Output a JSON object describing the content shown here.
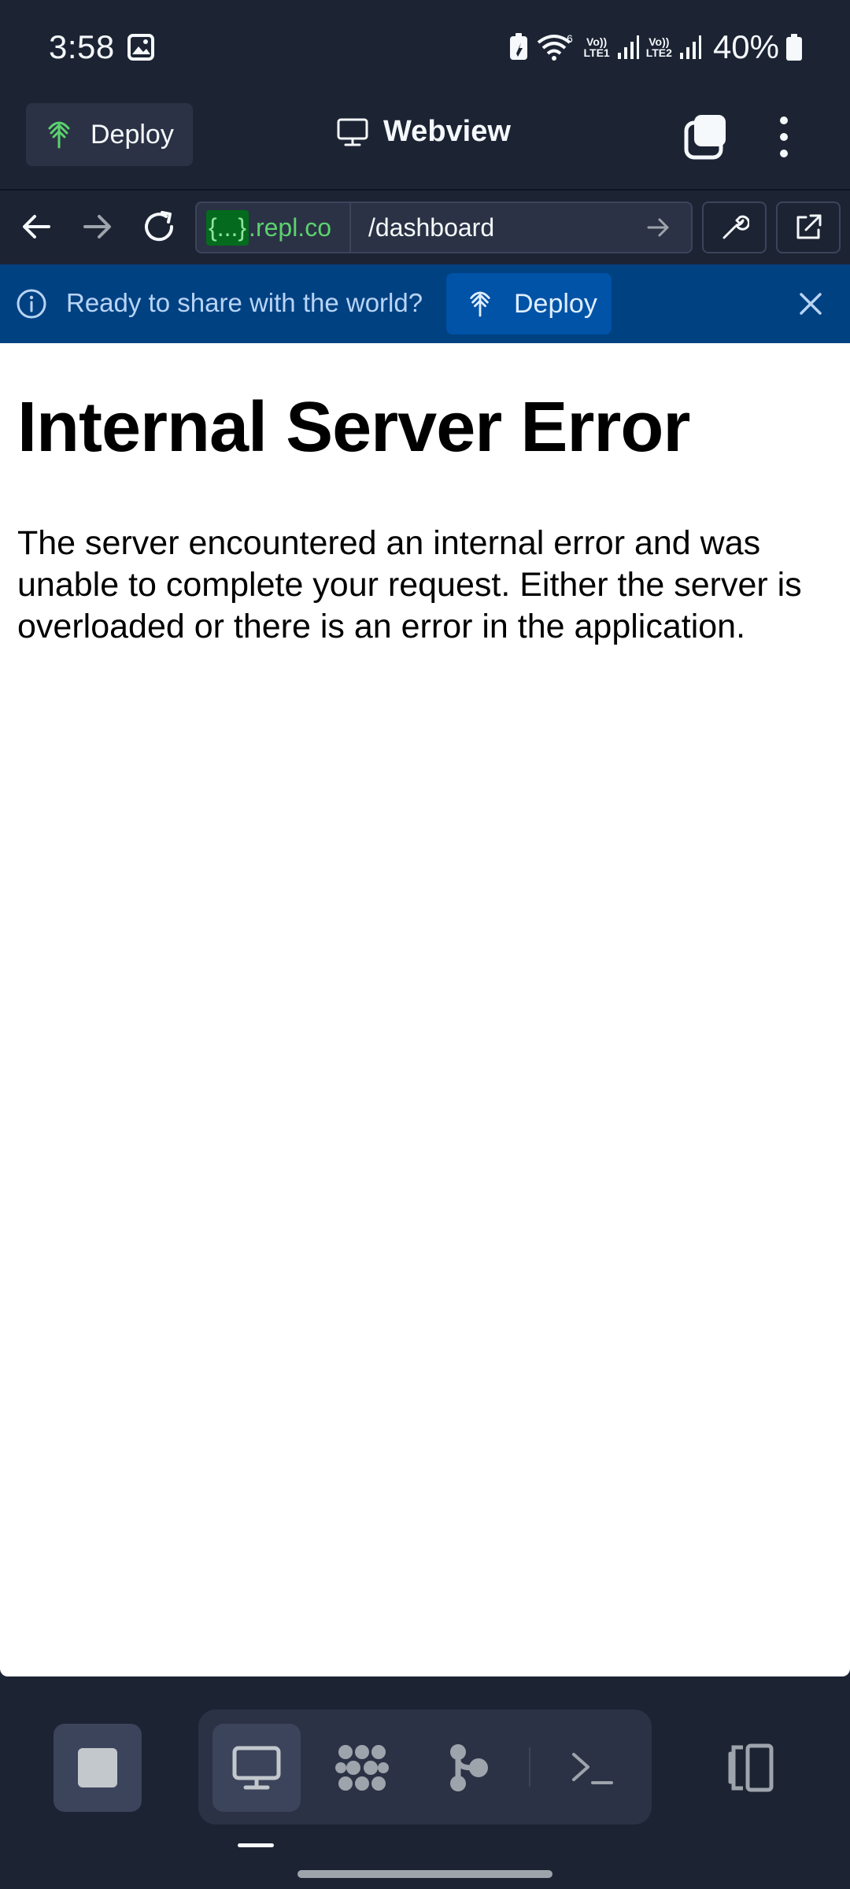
{
  "status_bar": {
    "time": "3:58",
    "wifi_badge": "6",
    "sim1": {
      "top": "Vo))",
      "bottom": "LTE1"
    },
    "sim2": {
      "top": "Vo))",
      "bottom": "LTE2"
    },
    "battery_percent": "40%"
  },
  "app_bar": {
    "deploy_label": "Deploy",
    "title": "Webview"
  },
  "url_bar": {
    "host_mask": "{...}",
    "host_suffix": ".repl.co",
    "path": "/dashboard"
  },
  "banner": {
    "message": "Ready to share with the world?",
    "deploy_label": "Deploy"
  },
  "page": {
    "heading": "Internal Server Error",
    "body": "The server encountered an internal error and was unable to complete your request. Either the server is overloaded or there is an error in the application."
  },
  "colors": {
    "background": "#1c2333",
    "surface": "#2b3245",
    "banner": "#004182",
    "accent_green": "#5bd26e"
  },
  "icons": {
    "deploy": "deploy-icon",
    "monitor": "monitor-icon",
    "back": "arrow-left-icon",
    "forward": "arrow-right-icon",
    "reload": "reload-icon",
    "wrench": "wrench-icon",
    "external": "external-link-icon",
    "info": "info-icon",
    "close": "close-icon"
  }
}
